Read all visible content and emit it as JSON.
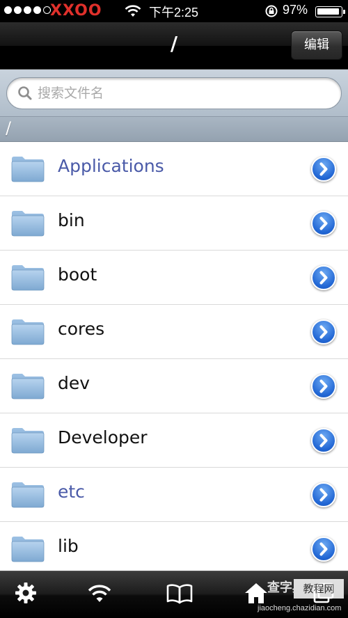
{
  "status_bar": {
    "carrier": "XXOO",
    "time": "下午2:25",
    "battery_percent": "97%",
    "battery_level": 0.97,
    "signal_bars_filled": 4
  },
  "nav": {
    "title": "/",
    "edit_label": "编辑"
  },
  "search": {
    "placeholder": "搜索文件名",
    "value": ""
  },
  "path": {
    "current": "/"
  },
  "files": [
    {
      "name": "Applications",
      "highlight": true
    },
    {
      "name": "bin",
      "highlight": false
    },
    {
      "name": "boot",
      "highlight": false
    },
    {
      "name": "cores",
      "highlight": false
    },
    {
      "name": "dev",
      "highlight": false
    },
    {
      "name": "Developer",
      "highlight": false
    },
    {
      "name": "etc",
      "highlight": true
    },
    {
      "name": "lib",
      "highlight": false
    }
  ],
  "tabs": [
    {
      "icon": "gear-icon"
    },
    {
      "icon": "wifi-icon"
    },
    {
      "icon": "book-icon"
    },
    {
      "icon": "home-icon"
    },
    {
      "icon": "windows-icon"
    }
  ],
  "watermark": {
    "line1": "查字典",
    "box": "教程网",
    "line2": "jiaocheng.chazidian.com"
  },
  "colors": {
    "link": "#4a5aa8",
    "carrier_red": "#e0302b",
    "disclosure_blue": "#2166d4"
  }
}
